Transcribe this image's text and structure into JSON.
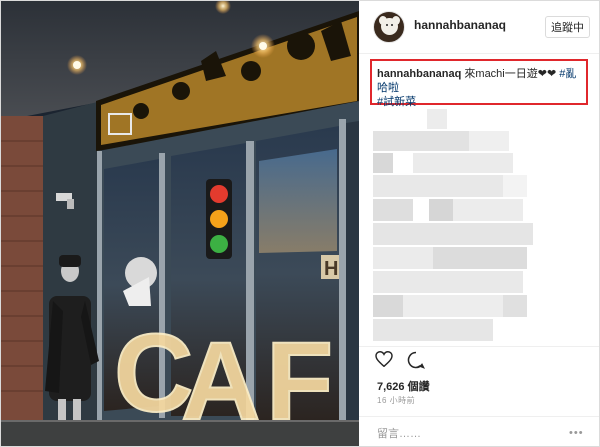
{
  "header": {
    "username": "hannahbananaq",
    "follow_label": "追蹤中"
  },
  "caption": {
    "username": "hannahbananaq",
    "text": "來machi一日遊❤❤",
    "tag1": "#亂哈啦",
    "tag2": "#試新菜"
  },
  "actions": {
    "heart": "heart-icon",
    "comment": "comment-icon"
  },
  "stats": {
    "likes": "7,626 個讚",
    "time": "16 小時前"
  },
  "comment": {
    "placeholder": "留言……",
    "more": "•••"
  },
  "photo": {
    "sign_letters": [
      "C",
      "A",
      "F"
    ],
    "window_letter": "H"
  },
  "colors": {
    "highlight": "#e0272c",
    "hashtag": "#003569"
  }
}
